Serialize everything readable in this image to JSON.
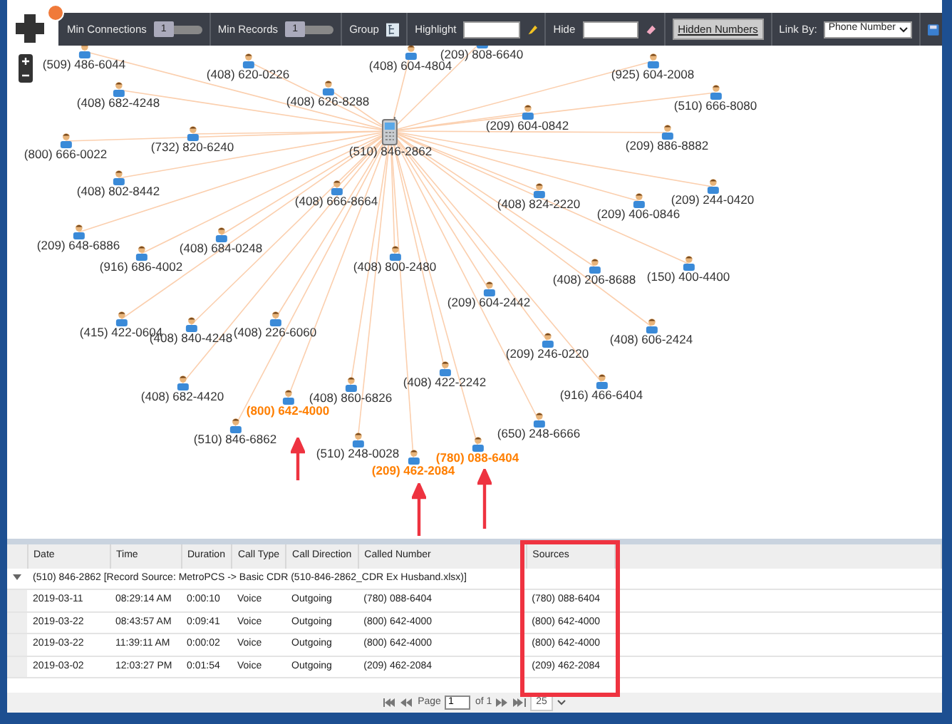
{
  "toolbar": {
    "sliders": [
      {
        "label": "Min Connections",
        "value": "1",
        "level": 0
      },
      {
        "label": "Min Records",
        "value": "1",
        "level": 0
      }
    ],
    "group_label": "Group",
    "highlight": {
      "label": "Highlight"
    },
    "hide": {
      "label": "Hide"
    },
    "hidden_numbers_button": "Hidden Numbers",
    "link_by": {
      "label": "Link By:",
      "value": "Phone Number"
    }
  },
  "graph": {
    "center": "(510) 846-2862",
    "nodes": [
      {
        "label": "(509) 486-6044",
        "highlighted": false
      },
      {
        "label": "(408) 620-0226",
        "highlighted": false
      },
      {
        "label": "(408) 604-4804",
        "highlighted": false
      },
      {
        "label": "(209) 808-6640",
        "highlighted": false
      },
      {
        "label": "(408) 682-4248",
        "highlighted": false
      },
      {
        "label": "(408) 626-8288",
        "highlighted": false
      },
      {
        "label": "(925) 604-2008",
        "highlighted": false
      },
      {
        "label": "(510) 666-8080",
        "highlighted": false
      },
      {
        "label": "(209) 604-0842",
        "highlighted": false
      },
      {
        "label": "(732) 820-6240",
        "highlighted": false
      },
      {
        "label": "(800) 666-0022",
        "highlighted": false
      },
      {
        "label": "(209) 886-8882",
        "highlighted": false
      },
      {
        "label": "(408) 802-8442",
        "highlighted": false
      },
      {
        "label": "(408) 666-8664",
        "highlighted": false
      },
      {
        "label": "(408) 824-2220",
        "highlighted": false
      },
      {
        "label": "(209) 406-0846",
        "highlighted": false
      },
      {
        "label": "(209) 244-0420",
        "highlighted": false
      },
      {
        "label": "(209) 648-6886",
        "highlighted": false
      },
      {
        "label": "(408) 684-0248",
        "highlighted": false
      },
      {
        "label": "(916) 686-4002",
        "highlighted": false
      },
      {
        "label": "(408) 800-2480",
        "highlighted": false
      },
      {
        "label": "(408) 206-8688",
        "highlighted": false
      },
      {
        "label": "(150) 400-4400",
        "highlighted": false
      },
      {
        "label": "(209) 604-2442",
        "highlighted": false
      },
      {
        "label": "(408) 606-2424",
        "highlighted": false
      },
      {
        "label": "(415) 422-0604",
        "highlighted": false
      },
      {
        "label": "(408) 840-4248",
        "highlighted": false
      },
      {
        "label": "(408) 226-6060",
        "highlighted": false
      },
      {
        "label": "(209) 246-0220",
        "highlighted": false
      },
      {
        "label": "(408) 682-4420",
        "highlighted": false
      },
      {
        "label": "(408) 860-6826",
        "highlighted": false
      },
      {
        "label": "(408) 422-2242",
        "highlighted": false
      },
      {
        "label": "(916) 466-6404",
        "highlighted": false
      },
      {
        "label": "(800) 642-4000",
        "highlighted": true
      },
      {
        "label": "(650) 248-6666",
        "highlighted": false
      },
      {
        "label": "(510) 846-6862",
        "highlighted": false
      },
      {
        "label": "(510) 248-0028",
        "highlighted": false
      },
      {
        "label": "(209) 462-2084",
        "highlighted": true
      },
      {
        "label": "(780) 088-6404",
        "highlighted": true
      }
    ]
  },
  "table": {
    "columns": [
      "Date",
      "Time",
      "Duration",
      "Call Type",
      "Call Direction",
      "Called Number",
      "Sources"
    ],
    "group": {
      "label": "(510) 846-2862 [Record Source: MetroPCS -> Basic CDR (510-846-2862_CDR Ex Husband.xlsx)]",
      "expanded": true
    },
    "rows": [
      [
        "2019-03-11",
        "08:29:14 AM",
        "0:00:10",
        "Voice",
        "Outgoing",
        "(780) 088-6404",
        "(780) 088-6404"
      ],
      [
        "2019-03-22",
        "08:43:57 AM",
        "0:09:41",
        "Voice",
        "Outgoing",
        "(800) 642-4000",
        "(800) 642-4000"
      ],
      [
        "2019-03-22",
        "11:39:11 AM",
        "0:00:02",
        "Voice",
        "Outgoing",
        "(800) 642-4000",
        "(800) 642-4000"
      ],
      [
        "2019-03-02",
        "12:03:27 PM",
        "0:01:54",
        "Voice",
        "Outgoing",
        "(209) 462-2084",
        "(209) 462-2084"
      ]
    ]
  },
  "pagination": {
    "page_label": "Page",
    "page": "1",
    "of": "of 1",
    "page_size": "25"
  }
}
